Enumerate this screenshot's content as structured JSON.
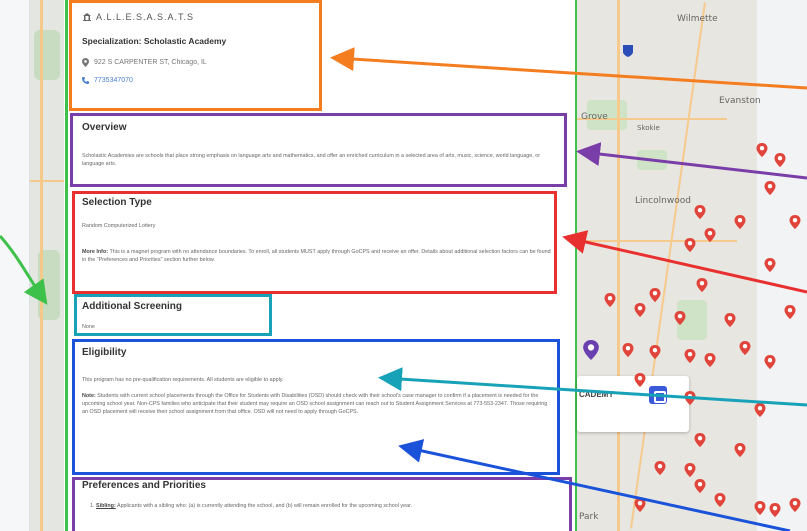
{
  "school": {
    "name": "A.L.L.E.S.A.S.A.T.S",
    "specialization": "Specialization: Scholastic Academy",
    "address": "922 S CARPENTER ST, Chicago, IL",
    "phone": "7735347070"
  },
  "overview": {
    "title": "Overview",
    "text": "Scholastic Academies are schools that place strong emphasis on language arts and mathematics, and offer an enriched curriculum in a selected area of arts, music, science, world language, or language arts."
  },
  "selection": {
    "title": "Selection Type",
    "type": "Random Computerized Lottery",
    "more_label": "More Info:",
    "more_text": "This is a magnet program with no attendance boundaries. To enroll, all students MUST apply through GoCPS and receive an offer. Details about additional selection factors can be found in the \"Preferences and Priorities\" section further below."
  },
  "screening": {
    "title": "Additional Screening",
    "value": "None"
  },
  "eligibility": {
    "title": "Eligibility",
    "text": "This program has no pre-qualification requirements. All students are eligible to apply.",
    "note_label": "Note:",
    "note_text": "Students with current school placements through the Office for Students with Disabilities (OSD) should check with their school's case manager to confirm if a placement is needed for the upcoming school year. Non-CPS families who anticipate that their student may require an OSD school assignment can reach out to Student Assignment Services at 773-553-2347. Those requiring an OSD placement will receive their school assignment from that office. OSD will not need to apply through GoCPS."
  },
  "preferences": {
    "title": "Preferences and Priorities",
    "item1_label": "Sibling:",
    "item1_text": "Applicants with a sibling who: (a) is currently attending the school, and (b) will remain enrolled for the upcoming school year."
  },
  "map": {
    "labels": [
      "Wilmette",
      "Evanston",
      "Grove",
      "Skokie",
      "Lincolnwood",
      "Park"
    ],
    "card_text": "CADEMY"
  },
  "colors": {
    "orange": "#f47d20",
    "purple": "#7a3ea8",
    "red": "#e83030",
    "teal": "#17a2b8",
    "blue": "#1a52d9",
    "green": "#3ec14a",
    "pin": "#e0443a"
  }
}
